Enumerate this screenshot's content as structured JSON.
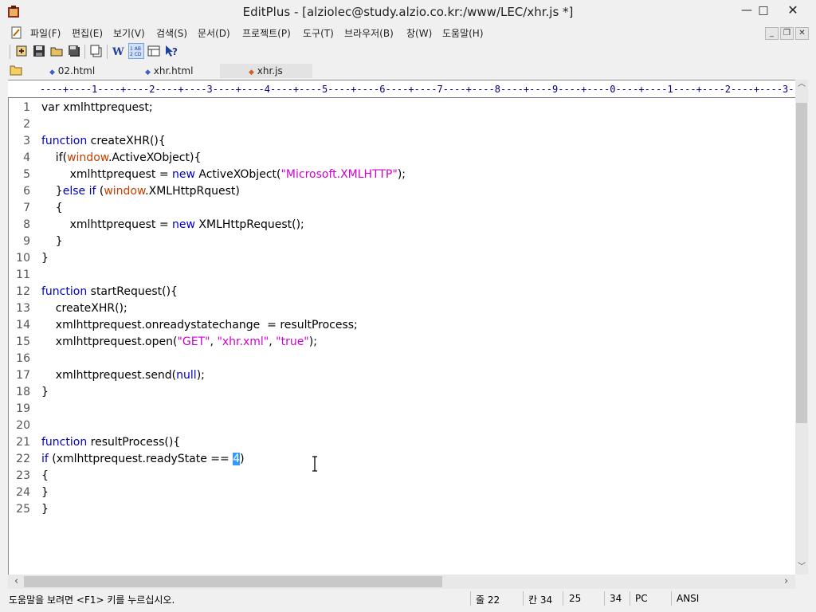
{
  "window": {
    "title": "EditPlus - [alziolec@study.alzio.co.kr:/www/LEC/xhr.js *]",
    "minimize": "—",
    "maximize": "□",
    "close": "✕"
  },
  "menu": {
    "items": [
      "파일(F)",
      "편집(E)",
      "보기(V)",
      "검색(S)",
      "문서(D)",
      "프로젝트(P)",
      "도구(T)",
      "브라우저(B)",
      "창(W)",
      "도움말(H)"
    ]
  },
  "mdi": {
    "minimize": "_",
    "restore": "❐",
    "close": "✕"
  },
  "tabs": [
    {
      "label": "02.html"
    },
    {
      "label": "xhr.html"
    },
    {
      "label": "xhr.js"
    }
  ],
  "ruler": "----+----1----+----2----+----3----+----4----+----5----+----6----+----7----+----8----+----9----+----0----+----1----+----2----+----3----+",
  "editor": {
    "lines": [
      {
        "n": "1"
      },
      {
        "n": "2"
      },
      {
        "n": "3"
      },
      {
        "n": "4"
      },
      {
        "n": "5"
      },
      {
        "n": "6"
      },
      {
        "n": "7"
      },
      {
        "n": "8"
      },
      {
        "n": "9"
      },
      {
        "n": "10"
      },
      {
        "n": "11"
      },
      {
        "n": "12"
      },
      {
        "n": "13"
      },
      {
        "n": "14"
      },
      {
        "n": "15"
      },
      {
        "n": "16"
      },
      {
        "n": "17"
      },
      {
        "n": "18"
      },
      {
        "n": "19"
      },
      {
        "n": "20"
      },
      {
        "n": "21"
      },
      {
        "n": "22"
      },
      {
        "n": "23"
      },
      {
        "n": "24"
      },
      {
        "n": "25"
      }
    ],
    "code": {
      "l1": "var xmlhttprequest;",
      "l3a": "function",
      "l3b": " createXHR(){",
      "l4a": "    if(",
      "l4b": "window",
      "l4c": ".ActiveXObject){",
      "l5a": "        xmlhttprequest = ",
      "l5b": "new",
      "l5c": " ActiveXObject(",
      "l5d": "\"Microsoft.XMLHTTP\"",
      "l5e": ");",
      "l6a": "    }",
      "l6b": "else if",
      "l6c": " (",
      "l6d": "window",
      "l6e": ".XMLHttpRquest)",
      "l7": "    {",
      "l8a": "        xmlhttprequest = ",
      "l8b": "new",
      "l8c": " XMLHttpRequest();",
      "l9": "    }",
      "l10": "}",
      "l12a": "function",
      "l12b": " startRequest(){",
      "l13": "    createXHR();",
      "l14": "    xmlhttprequest.onreadystatechange  = resultProcess;",
      "l15a": "    xmlhttprequest.open(",
      "l15b": "\"GET\"",
      "l15c": ", ",
      "l15d": "\"xhr.xml\"",
      "l15e": ", ",
      "l15f": "\"true\"",
      "l15g": ");",
      "l17a": "    xmlhttprequest.send(",
      "l17b": "null",
      "l17c": ");",
      "l18": "}",
      "l21a": "function",
      "l21b": " resultProcess(){",
      "l22a": "if",
      "l22b": " (xmlhttprequest.readyState == ",
      "l22c": "4",
      "l22d": ")",
      "l23": "{",
      "l24": "}",
      "l25": "}"
    }
  },
  "status": {
    "help": "도움말을 보려면 <F1> 키를 누르십시오.",
    "line": "줄 22",
    "col": "칸 34",
    "v1": "25",
    "v2": "34",
    "mode": "PC",
    "encoding": "ANSI"
  }
}
